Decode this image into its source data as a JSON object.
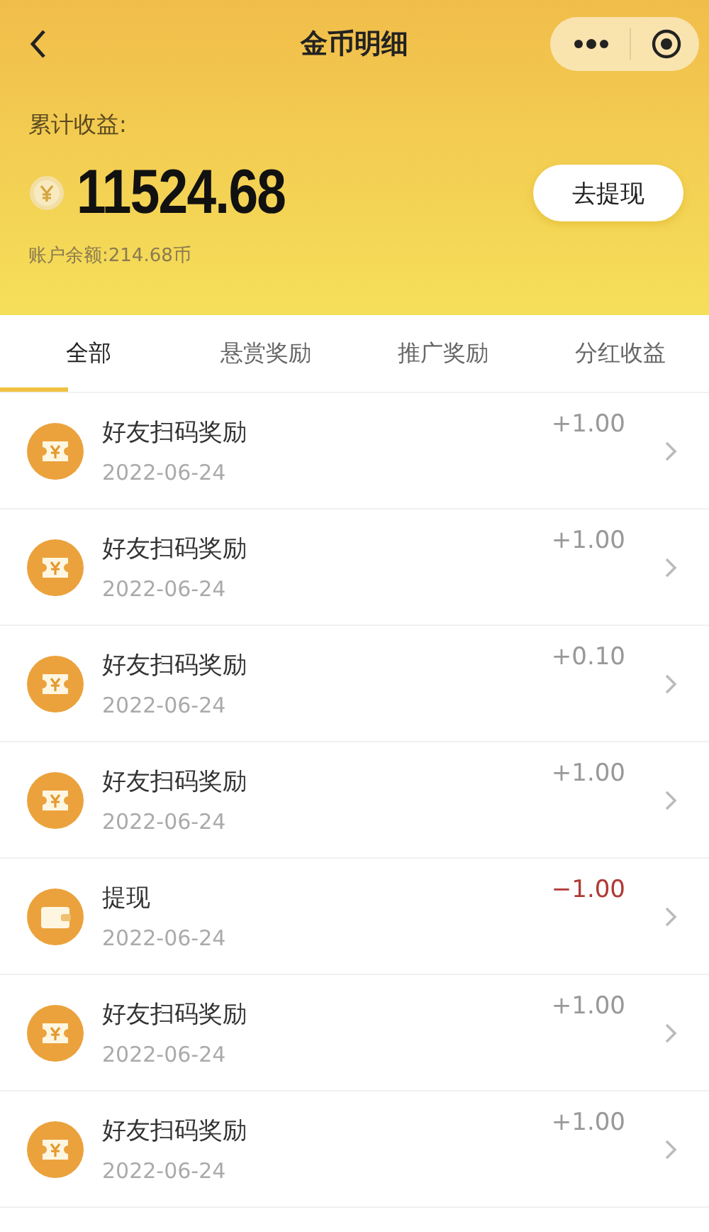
{
  "nav": {
    "title": "金币明细"
  },
  "summary": {
    "label": "累计收益:",
    "total": "11524.68",
    "button": "去提现",
    "balance": "账户余额:214.68币"
  },
  "tabs": [
    {
      "label": "全部",
      "selected": true
    },
    {
      "label": "悬赏奖励",
      "selected": false
    },
    {
      "label": "推广奖励",
      "selected": false
    },
    {
      "label": "分红收益",
      "selected": false
    }
  ],
  "records": [
    {
      "kind": "reward",
      "title": "好友扫码奖励",
      "date": "2022-06-24",
      "amount": "+1.00"
    },
    {
      "kind": "reward",
      "title": "好友扫码奖励",
      "date": "2022-06-24",
      "amount": "+1.00"
    },
    {
      "kind": "reward",
      "title": "好友扫码奖励",
      "date": "2022-06-24",
      "amount": "+0.10"
    },
    {
      "kind": "reward",
      "title": "好友扫码奖励",
      "date": "2022-06-24",
      "amount": "+1.00"
    },
    {
      "kind": "withdraw",
      "title": "提现",
      "date": "2022-06-24",
      "amount": "−1.00"
    },
    {
      "kind": "reward",
      "title": "好友扫码奖励",
      "date": "2022-06-24",
      "amount": "+1.00"
    },
    {
      "kind": "reward",
      "title": "好友扫码奖励",
      "date": "2022-06-24",
      "amount": "+1.00"
    }
  ]
}
